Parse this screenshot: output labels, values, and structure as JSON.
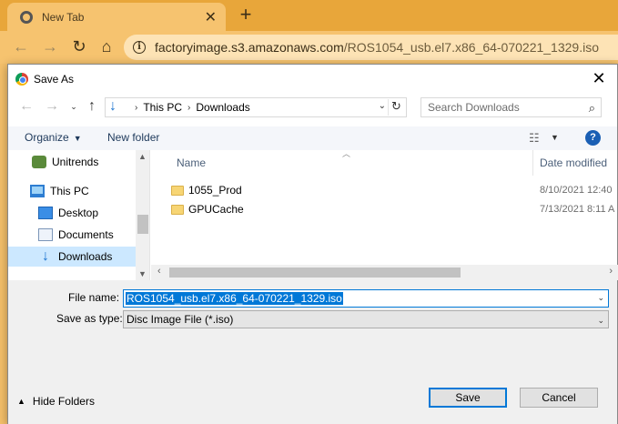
{
  "browser": {
    "tab_title": "New Tab",
    "tab_close": "✕",
    "new_tab": "+",
    "url_host": "factoryimage.s3.amazonaws.com",
    "url_path": "/ROS1054_usb.el7.x86_64-070221_1329.iso"
  },
  "dialog": {
    "title": "Save As",
    "path": [
      "This PC",
      "Downloads"
    ],
    "search_placeholder": "Search Downloads",
    "organize_label": "Organize",
    "new_folder_label": "New folder",
    "help_label": "?"
  },
  "nav_pane": {
    "items": [
      {
        "label": "Unitrends"
      },
      {
        "label": "This PC"
      },
      {
        "label": "Desktop"
      },
      {
        "label": "Documents"
      },
      {
        "label": "Downloads",
        "selected": true
      }
    ]
  },
  "file_list": {
    "columns": [
      "Name",
      "Date modified"
    ],
    "rows": [
      {
        "name": "1055_Prod",
        "date": "8/10/2021 12:40"
      },
      {
        "name": "GPUCache",
        "date": "7/13/2021 8:11 A"
      }
    ]
  },
  "save_fields": {
    "file_name_label": "File name:",
    "file_name_value": "ROS1054_usb.el7.x86_64-070221_1329.iso",
    "save_type_label": "Save as type:",
    "save_type_value": "Disc Image File (*.iso)"
  },
  "footer": {
    "hide_folders_label": "Hide Folders",
    "save_label": "Save",
    "cancel_label": "Cancel"
  }
}
